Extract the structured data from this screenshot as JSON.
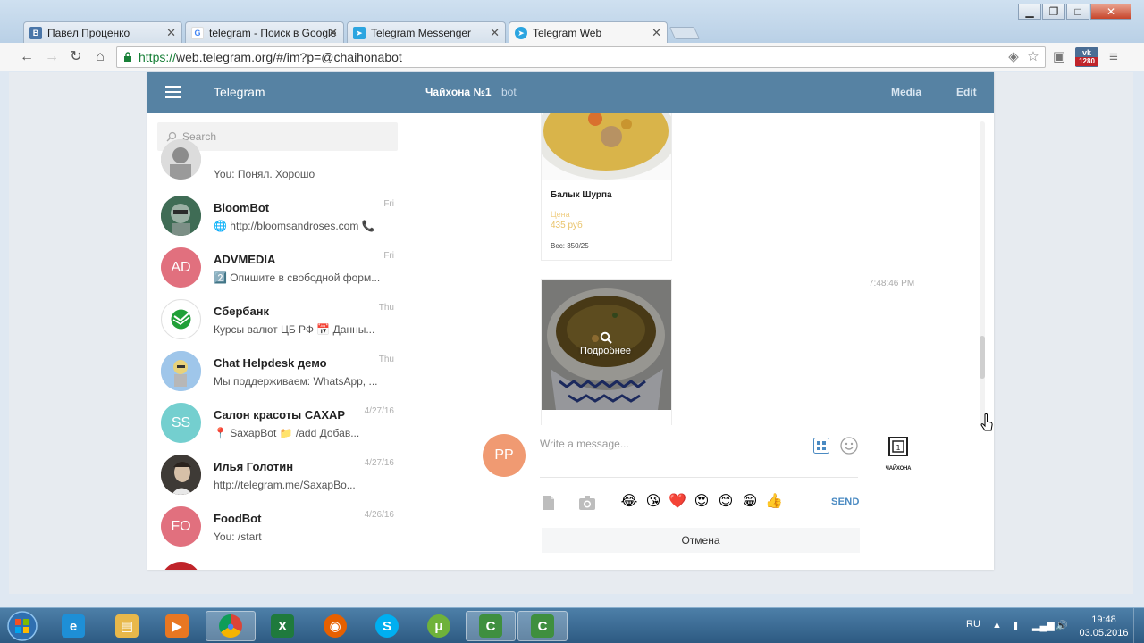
{
  "browser": {
    "tabs": [
      {
        "title": "Павел Проценко",
        "icon": "vk-icon",
        "color": "#4a76a8",
        "glyph": "В"
      },
      {
        "title": "telegram - Поиск в Google",
        "icon": "google-icon",
        "color": "#ffffff",
        "glyph": "G"
      },
      {
        "title": "Telegram Messenger",
        "icon": "telegram-icon",
        "color": "#2ca5e0",
        "glyph": ""
      },
      {
        "title": "Telegram Web",
        "icon": "telegram-icon",
        "color": "#2ca5e0",
        "glyph": ""
      }
    ],
    "url_secure": "https://",
    "url_rest": "web.telegram.org/#/im?p=@chaihonabot",
    "ext_vk_top": "vk",
    "ext_vk_bottom": "1280"
  },
  "telegram": {
    "app_title": "Telegram",
    "peer_name": "Чайхона №1",
    "peer_status": "bot",
    "media_label": "Media",
    "edit_label": "Edit",
    "search_placeholder": "Search",
    "dialogs": [
      {
        "name": "",
        "message": "You: Понял. Хорошо",
        "date": "",
        "initials": "",
        "color": "#c8c8c8",
        "avatar": "photo"
      },
      {
        "name": "BloomBot",
        "message": "🌐 http://bloomsandroses.com 📞",
        "date": "Fri",
        "initials": "",
        "color": "#3f6c55",
        "avatar": "photo"
      },
      {
        "name": "ADVMEDIA",
        "message": "2️⃣ Опишите в свободной форм...",
        "date": "Fri",
        "initials": "AD",
        "color": "#e1707e",
        "avatar": "initials"
      },
      {
        "name": "Сбербанк",
        "message": "Курсы валют ЦБ РФ 📅 Данны...",
        "date": "Thu",
        "initials": "",
        "color": "#ffffff",
        "avatar": "logo"
      },
      {
        "name": "Chat Helpdesk демо",
        "message": "Мы поддерживаем: WhatsApp, ...",
        "date": "Thu",
        "initials": "",
        "color": "#9fc6ea",
        "avatar": "photo"
      },
      {
        "name": "Салон красоты САХАР",
        "message": "📍 SaxapBot 📁 /add Добав...",
        "date": "4/27/16",
        "initials": "SS",
        "color": "#74cfcf",
        "avatar": "initials"
      },
      {
        "name": "Илья Голотин",
        "message": "http://telegram.me/SaxapBo...",
        "date": "4/27/16",
        "initials": "",
        "color": "#5b4a3f",
        "avatar": "photo"
      },
      {
        "name": "FoodBot",
        "message": "You: /start",
        "date": "4/26/16",
        "initials": "FO",
        "color": "#e1707e",
        "avatar": "initials"
      }
    ],
    "cards": [
      {
        "title": "Балык Шурпа",
        "price_label": "Цена",
        "price": "435 руб",
        "weight": "Вес: 350/25"
      }
    ],
    "message_time": "7:48:46 PM",
    "more_label": "Подробнее",
    "my_initials": "PP",
    "my_color": "#f09a72",
    "message_placeholder": "Write a message...",
    "bot_logo_text": "ЧАЙХОНА",
    "emojis": [
      "😂",
      "😘",
      "❤️",
      "😍",
      "😊",
      "😁",
      "👍"
    ],
    "send_label": "SEND",
    "cancel_label": "Отмена",
    "accent": "#5682a3"
  },
  "taskbar": {
    "lang": "RU",
    "time": "19:48",
    "date": "03.05.2016",
    "apps": [
      {
        "name": "ie",
        "color": "#1e8fd6",
        "glyph": "e"
      },
      {
        "name": "explorer",
        "color": "#e8b84a",
        "glyph": "▤"
      },
      {
        "name": "media-player",
        "color": "#e87722",
        "glyph": "▶"
      },
      {
        "name": "chrome",
        "color": "#ffffff",
        "glyph": "●"
      },
      {
        "name": "excel",
        "color": "#1f7a3d",
        "glyph": "X"
      },
      {
        "name": "firefox",
        "color": "#e66000",
        "glyph": "◉"
      },
      {
        "name": "skype",
        "color": "#00aff0",
        "glyph": "S"
      },
      {
        "name": "utorrent",
        "color": "#6fb23a",
        "glyph": "μ"
      },
      {
        "name": "camtasia",
        "color": "#3f8f3f",
        "glyph": "C"
      },
      {
        "name": "camtasia-2",
        "color": "#3f8f3f",
        "glyph": "C"
      }
    ]
  }
}
